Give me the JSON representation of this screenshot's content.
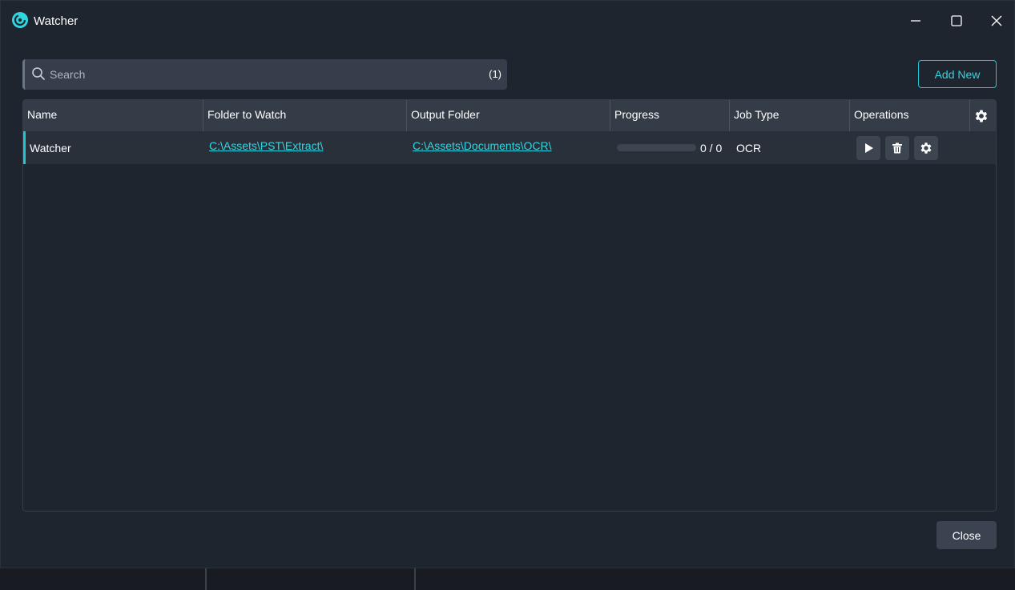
{
  "window": {
    "title": "Watcher",
    "icon": "watcher-logo-icon",
    "controls": [
      "minimize-icon",
      "maximize-icon",
      "close-icon"
    ]
  },
  "search": {
    "placeholder": "Search",
    "value": "",
    "count": "(1)"
  },
  "toolbar": {
    "add_new_label": "Add New"
  },
  "grid": {
    "columns": [
      "Name",
      "Folder to Watch",
      "Output Folder",
      "Progress",
      "Job Type",
      "Operations"
    ],
    "rows": [
      {
        "name": "Watcher",
        "folder_to_watch": "C:\\Assets\\PST\\Extract\\",
        "output_folder": "C:\\Assets\\Documents\\OCR\\",
        "progress_text": "0 / 0",
        "progress_fraction": 0,
        "job_type": "OCR",
        "operations": [
          "play-icon",
          "trash-icon",
          "gear-icon"
        ]
      }
    ]
  },
  "footer": {
    "close_label": "Close"
  },
  "colors": {
    "accent": "#21c6d3",
    "background": "#1f252e",
    "header": "#343c47",
    "row": "#29303a"
  }
}
